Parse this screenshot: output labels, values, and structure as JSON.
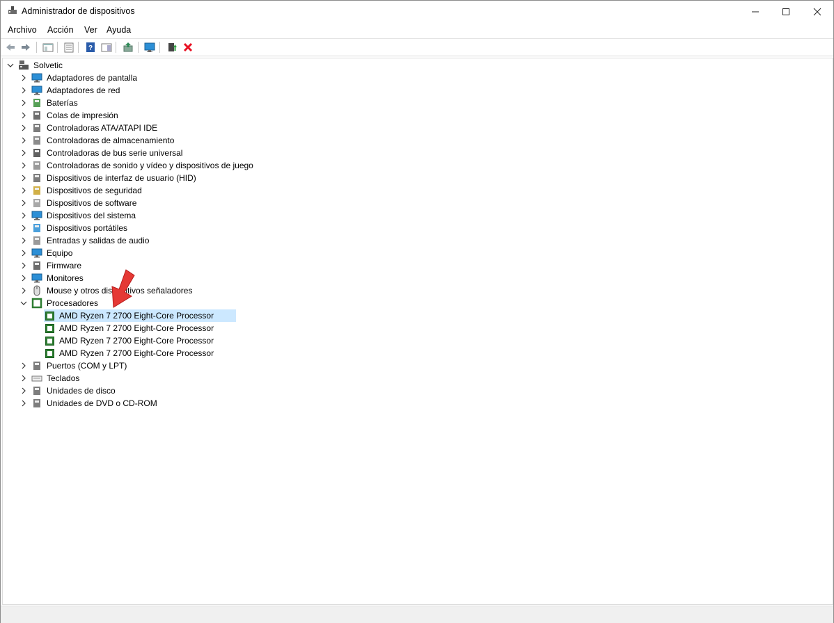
{
  "window": {
    "title": "Administrador de dispositivos"
  },
  "menu": [
    "Archivo",
    "Acción",
    "Ver",
    "Ayuda"
  ],
  "toolbar": {
    "icons": [
      "back-arrow-icon",
      "forward-arrow-icon",
      "show-hide-console-tree-icon",
      "properties-icon",
      "help-icon",
      "action-pane-icon",
      "update-driver-icon",
      "scan-hardware-changes-icon",
      "enable-device-icon",
      "uninstall-device-icon"
    ],
    "accent_red": "#e81123"
  },
  "tree": {
    "root": "Solvetic",
    "categories": [
      {
        "label": "Adaptadores de pantalla",
        "icon": "display-adapter-icon"
      },
      {
        "label": "Adaptadores de red",
        "icon": "network-adapter-icon"
      },
      {
        "label": "Baterías",
        "icon": "battery-icon"
      },
      {
        "label": "Colas de impresión",
        "icon": "printer-icon"
      },
      {
        "label": "Controladoras ATA/ATAPI IDE",
        "icon": "ide-controller-icon"
      },
      {
        "label": "Controladoras de almacenamiento",
        "icon": "storage-controller-icon"
      },
      {
        "label": "Controladoras de bus serie universal",
        "icon": "usb-icon"
      },
      {
        "label": "Controladoras de sonido y vídeo y dispositivos de juego",
        "icon": "sound-icon"
      },
      {
        "label": "Dispositivos de interfaz de usuario (HID)",
        "icon": "hid-icon"
      },
      {
        "label": "Dispositivos de seguridad",
        "icon": "security-device-icon"
      },
      {
        "label": "Dispositivos de software",
        "icon": "software-device-icon"
      },
      {
        "label": "Dispositivos del sistema",
        "icon": "system-device-icon"
      },
      {
        "label": "Dispositivos portátiles",
        "icon": "portable-device-icon"
      },
      {
        "label": "Entradas y salidas de audio",
        "icon": "audio-io-icon"
      },
      {
        "label": "Equipo",
        "icon": "computer-icon"
      },
      {
        "label": "Firmware",
        "icon": "firmware-icon"
      },
      {
        "label": "Monitores",
        "icon": "monitor-icon"
      },
      {
        "label": "Mouse y otros dispositivos señaladores",
        "icon": "mouse-icon"
      },
      {
        "label": "Procesadores",
        "icon": "processor-icon",
        "expanded": true,
        "children": [
          "AMD Ryzen 7 2700 Eight-Core Processor",
          "AMD Ryzen 7 2700 Eight-Core Processor",
          "AMD Ryzen 7 2700 Eight-Core Processor",
          "AMD Ryzen 7 2700 Eight-Core Processor"
        ]
      },
      {
        "label": "Puertos (COM y LPT)",
        "icon": "port-icon"
      },
      {
        "label": "Teclados",
        "icon": "keyboard-icon"
      },
      {
        "label": "Unidades de disco",
        "icon": "disk-drive-icon"
      },
      {
        "label": "Unidades de DVD o CD-ROM",
        "icon": "dvd-drive-icon"
      }
    ]
  },
  "colors": {
    "selection": "#cce8ff",
    "annotation_arrow": "#e53935"
  }
}
